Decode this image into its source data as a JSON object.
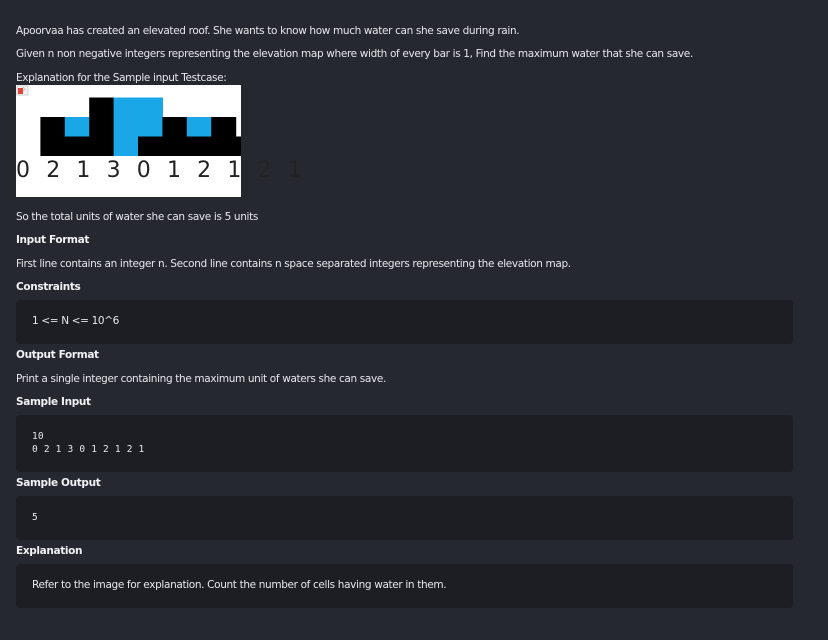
{
  "problem": {
    "intro_line1": "Apoorvaa has created an elevated roof. She wants to know how much water can she save during rain.",
    "intro_line2": "Given n non negative integers representing the elevation map where width of every bar is 1, Find the maximum water that she can save.",
    "explanation_caption": "Explanation for the Sample input Testcase:",
    "figure": {
      "heights": [
        0,
        2,
        1,
        3,
        0,
        1,
        2,
        1,
        2,
        1
      ],
      "water": [
        0,
        0,
        1,
        0,
        3,
        2,
        0,
        1,
        0,
        0
      ],
      "numbers_text": "0 2 1 3 0 1 2 1 2 1",
      "bar_color": "#000000",
      "water_color": "#1aa7e8",
      "background_color": "#ffffff"
    },
    "total_units_text": "So the total units of water she can save is 5 units"
  },
  "input_format": {
    "heading": "Input Format",
    "text": "First line contains an integer n. Second line contains n space separated integers representing the elevation map."
  },
  "constraints": {
    "heading": "Constraints",
    "text": "1 <= N <= 10^6"
  },
  "output_format": {
    "heading": "Output Format",
    "text": "Print a single integer containing the maximum unit of waters she can save."
  },
  "sample_input": {
    "heading": "Sample Input",
    "text": "10\n0 2 1 3 0 1 2 1 2 1"
  },
  "sample_output": {
    "heading": "Sample Output",
    "text": "5"
  },
  "explanation": {
    "heading": "Explanation",
    "text": "Refer to the image for explanation. Count the number of cells having water in them."
  },
  "colors": {
    "page_background": "#262830",
    "box_background": "#1c1e24",
    "text": "#e6e7ea"
  }
}
